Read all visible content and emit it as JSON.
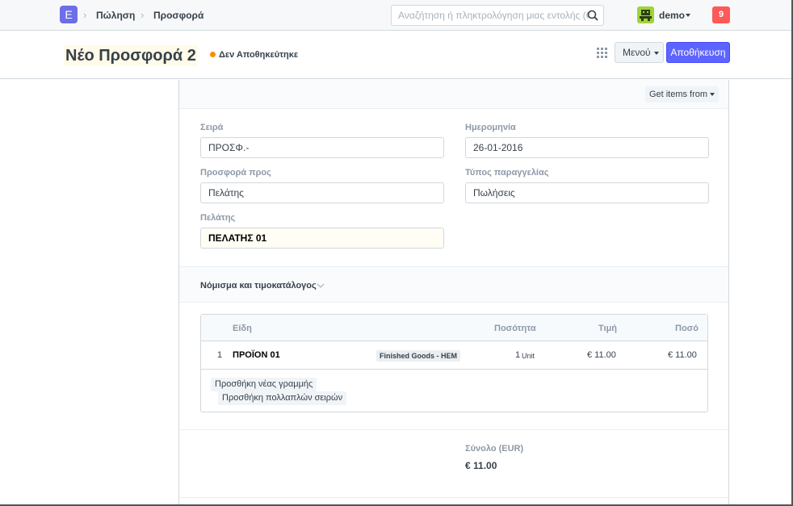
{
  "app": {
    "logo_letter": "E"
  },
  "breadcrumb": [
    "Πώληση",
    "Προσφορά"
  ],
  "search": {
    "placeholder": "Αναζήτηση ή πληκτρολόγηση μιας εντολής (Ctrl + G)"
  },
  "user": {
    "name": "demo"
  },
  "notifications": {
    "count": "9"
  },
  "page": {
    "title": "Νέο Προσφορά 2",
    "status": "Δεν Αποθηκεύτηκε",
    "status_color": "#ff8c00",
    "menu_label": "Μενού",
    "save_label": "Αποθήκευση"
  },
  "toolbar": {
    "get_items_label": "Get items from"
  },
  "fields": {
    "series": {
      "label": "Σειρά",
      "value": "ΠΡΟΣΦ.-"
    },
    "date": {
      "label": "Ημερομηνία",
      "value": "26-01-2016"
    },
    "quotation_to": {
      "label": "Προσφορά προς",
      "value": "Πελάτης"
    },
    "order_type": {
      "label": "Τύπος παραγγελίας",
      "value": "Πωλήσεις"
    },
    "customer": {
      "label": "Πελάτης",
      "value": "ΠΕΛΑΤΗΣ 01"
    }
  },
  "section": {
    "currency_price_list": "Νόμισμα και τιμοκατάλογος"
  },
  "items_table": {
    "headers": {
      "item": "Είδη",
      "qty": "Ποσότητα",
      "rate": "Τιμή",
      "amount": "Ποσό"
    },
    "rows": [
      {
        "idx": "1",
        "item": "ΠΡΟΪΟΝ 01",
        "group": "Finished Goods - HEM",
        "qty": "1",
        "uom": "Unit",
        "rate": "€ 11.00",
        "amount": "€ 11.00"
      }
    ],
    "add_row": "Προσθήκη νέας γραμμής",
    "add_multiple": "Προσθήκη πολλαπλών σειρών"
  },
  "totals": {
    "label": "Σύνολο (EUR)",
    "value": "€ 11.00"
  },
  "colors": {
    "primary": "#5e64ff",
    "notification": "#ff5858",
    "brand": "#6c6fe6"
  }
}
